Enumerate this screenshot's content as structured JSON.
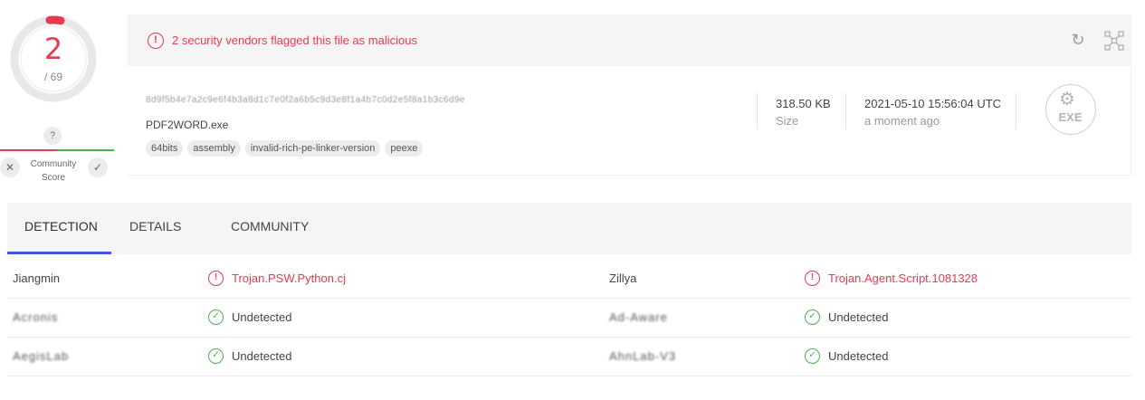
{
  "score": {
    "detected": "2",
    "total": "/ 69",
    "accent_color": "#e63b52",
    "question_mark": "?",
    "community_label": "Community Score",
    "vote_down_icon": "x-icon",
    "vote_up_icon": "check-icon"
  },
  "alert": {
    "icon": "exclamation-circle-icon",
    "text": "2 security vendors flagged this file as malicious",
    "reanalyze_icon": "refresh-icon",
    "graph_icon": "graph-icon"
  },
  "file": {
    "hash": "8d9f5b4e7a2c9e6f4b3a8d1c7e0f2a6b5c9d3e8f1a4b7c0d2e5f8a1b3c6d9e",
    "name": "PDF2WORD.exe",
    "tags": [
      "64bits",
      "assembly",
      "invalid-rich-pe-linker-version",
      "peexe"
    ],
    "size_value": "318.50 KB",
    "size_label": "Size",
    "date_value": "2021-05-10 15:56:04 UTC",
    "date_label": "a moment ago",
    "type_icon": "exe-file-icon",
    "type_label": "EXE"
  },
  "tabs": [
    "DETECTION",
    "DETAILS",
    "COMMUNITY"
  ],
  "detections": [
    {
      "left": {
        "vendor": "Jiangmin",
        "result": "Trojan.PSW.Python.cj",
        "status": "malicious",
        "blurred": false
      },
      "right": {
        "vendor": "Zillya",
        "result": "Trojan.Agent.Script.1081328",
        "status": "malicious",
        "blurred": false
      }
    },
    {
      "left": {
        "vendor": "Acronis",
        "result": "Undetected",
        "status": "clean",
        "blurred": true
      },
      "right": {
        "vendor": "Ad-Aware",
        "result": "Undetected",
        "status": "clean",
        "blurred": true
      }
    },
    {
      "left": {
        "vendor": "AegisLab",
        "result": "Undetected",
        "status": "clean",
        "blurred": true
      },
      "right": {
        "vendor": "AhnLab-V3",
        "result": "Undetected",
        "status": "clean",
        "blurred": true
      }
    }
  ]
}
